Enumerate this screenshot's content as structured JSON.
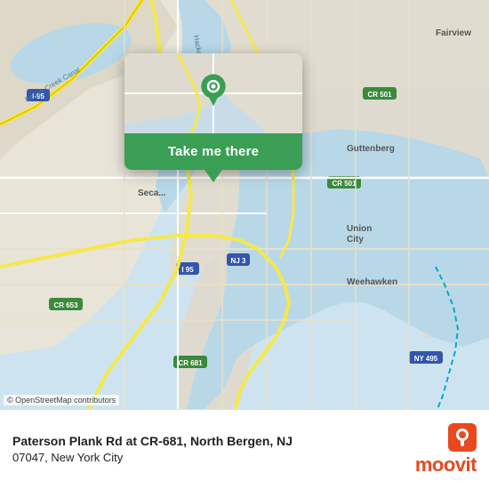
{
  "map": {
    "background_color": "#d4e8f0",
    "attribution": "© OpenStreetMap contributors"
  },
  "popup": {
    "button_label": "Take me there",
    "button_color": "#3a9e54"
  },
  "location": {
    "name": "Paterson Plank Rd at CR-681, North Bergen, NJ",
    "name_line1": "Paterson Plank Rd at CR-681, North Bergen, NJ",
    "city": "07047, New York City",
    "full_line1": "Paterson Plank Rd at CR-681, North Bergen, NJ",
    "full_line2": "07047, New York City"
  },
  "branding": {
    "name": "moovit",
    "color": "#e8491e"
  }
}
